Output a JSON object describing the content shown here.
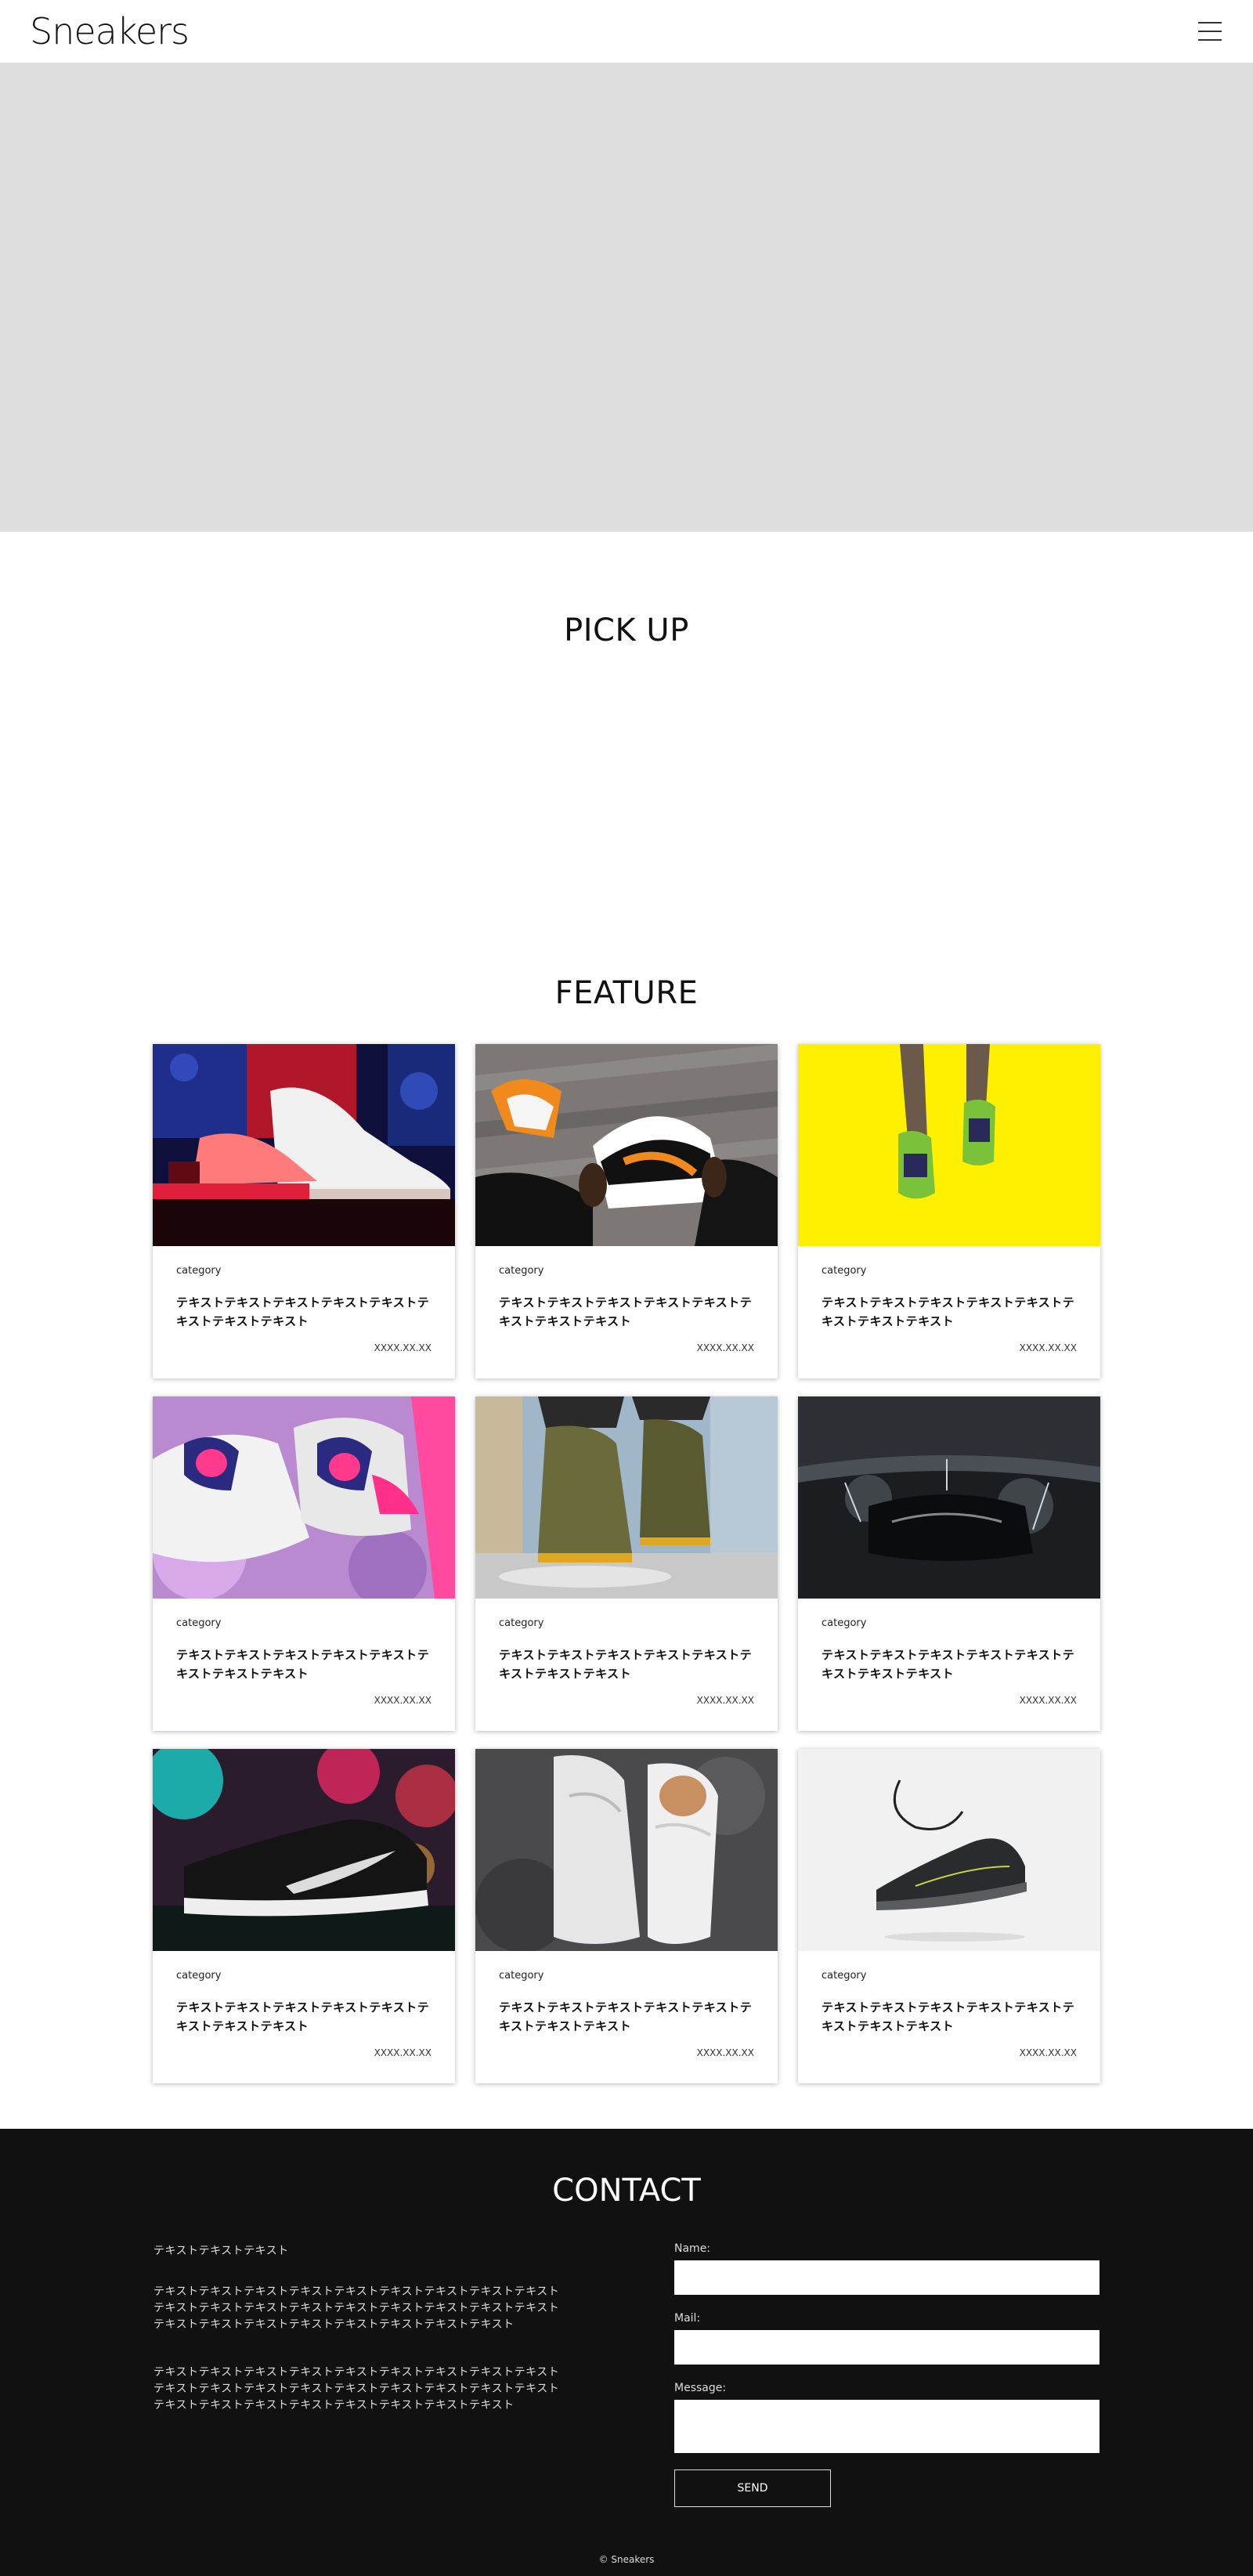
{
  "header": {
    "logo": "Sneakers",
    "menu_icon": "hamburger-menu-icon"
  },
  "pickup": {
    "title": "PICK UP"
  },
  "feature": {
    "title": "FEATURE",
    "cards": [
      {
        "category": "category",
        "text": "テキストテキストテキストテキストテキストテキストテキストテキスト",
        "date": "XXXX.XX.XX",
        "image": "red-lit-sneakers-dj-deck-photo"
      },
      {
        "category": "category",
        "text": "テキストテキストテキストテキストテキストテキストテキストテキスト",
        "date": "XXXX.XX.XX",
        "image": "hands-holding-orange-black-sneaker-photo"
      },
      {
        "category": "category",
        "text": "テキストテキストテキストテキストテキストテキストテキストテキスト",
        "date": "XXXX.XX.XX",
        "image": "green-sneakers-yellow-background-photo"
      },
      {
        "category": "category",
        "text": "テキストテキストテキストテキストテキストテキストテキストテキスト",
        "date": "XXXX.XX.XX",
        "image": "pink-purple-sneakers-photo"
      },
      {
        "category": "category",
        "text": "テキストテキストテキストテキストテキストテキストテキストテキスト",
        "date": "XXXX.XX.XX",
        "image": "olive-boots-splash-photo"
      },
      {
        "category": "category",
        "text": "テキストテキストテキストテキストテキストテキストテキストテキスト",
        "date": "XXXX.XX.XX",
        "image": "black-sneaker-water-splash-photo"
      },
      {
        "category": "category",
        "text": "テキストテキストテキストテキストテキストテキストテキストテキスト",
        "date": "XXXX.XX.XX",
        "image": "black-white-running-shoe-neon-photo"
      },
      {
        "category": "category",
        "text": "テキストテキストテキストテキストテキストテキストテキストテキスト",
        "date": "XXXX.XX.XX",
        "image": "white-high-top-sneakers-photo"
      },
      {
        "category": "category",
        "text": "テキストテキストテキストテキストテキストテキストテキストテキスト",
        "date": "XXXX.XX.XX",
        "image": "floating-dark-sneaker-photo"
      }
    ]
  },
  "contact": {
    "title": "CONTACT",
    "lead": "テキストテキストテキスト",
    "paragraph1": "テキストテキストテキストテキストテキストテキストテキストテキストテキストテキストテキストテキストテキストテキストテキストテキストテキストテキストテキストテキストテキストテキストテキストテキストテキストテキスト",
    "paragraph2": "テキストテキストテキストテキストテキストテキストテキストテキストテキストテキストテキストテキストテキストテキストテキストテキストテキストテキストテキストテキストテキストテキストテキストテキストテキストテキスト",
    "name_label": "Name:",
    "name_value": "",
    "mail_label": "Mail:",
    "mail_value": "",
    "message_label": "Message:",
    "message_value": "",
    "send_label": "SEND"
  },
  "footer": {
    "copyright": "© Sneakers"
  },
  "colors": {
    "hero_bg": "#dedede",
    "contact_bg": "#111111",
    "card_yellow": "#fef000"
  }
}
